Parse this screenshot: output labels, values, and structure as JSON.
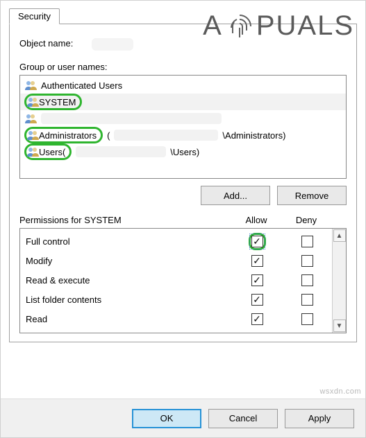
{
  "tab": {
    "label": "Security"
  },
  "object": {
    "label": "Object name:"
  },
  "group_section": {
    "label": "Group or user names:"
  },
  "groups": [
    {
      "name": "Authenticated Users",
      "suffix": "",
      "highlighted": false,
      "selected": false
    },
    {
      "name": "SYSTEM",
      "suffix": "",
      "highlighted": true,
      "selected": true
    },
    {
      "name": "",
      "suffix": "",
      "highlighted": false,
      "selected": false
    },
    {
      "name": "Administrators",
      "suffix": "\\Administrators)",
      "open_paren": " (",
      "highlighted": true,
      "selected": false
    },
    {
      "name": "Users",
      "suffix": "\\Users)",
      "open_paren": " (",
      "highlighted": true,
      "selected": false
    }
  ],
  "group_buttons": {
    "add": "Add...",
    "remove": "Remove"
  },
  "perm_header": {
    "label": "Permissions for SYSTEM",
    "allow": "Allow",
    "deny": "Deny"
  },
  "permissions": [
    {
      "name": "Full control",
      "allow": true,
      "deny": false,
      "highlight_allow": true
    },
    {
      "name": "Modify",
      "allow": true,
      "deny": false
    },
    {
      "name": "Read & execute",
      "allow": true,
      "deny": false
    },
    {
      "name": "List folder contents",
      "allow": true,
      "deny": false
    },
    {
      "name": "Read",
      "allow": true,
      "deny": false
    }
  ],
  "dialog_buttons": {
    "ok": "OK",
    "cancel": "Cancel",
    "apply": "Apply"
  },
  "watermark": {
    "brand_before": "A",
    "brand_after": "PUALS",
    "footer": "wsxdn.com"
  }
}
